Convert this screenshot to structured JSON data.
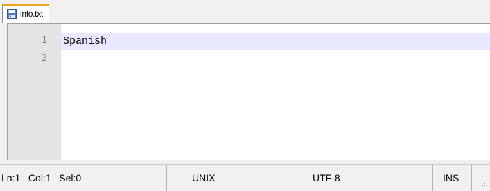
{
  "tabs": [
    {
      "label": "info.txt",
      "icon": "save-icon",
      "accent_color": "#f3a21b"
    }
  ],
  "editor": {
    "line_numbers": [
      "1",
      "2"
    ],
    "lines": [
      "Spanish",
      ""
    ],
    "current_line_color": "#e8e8ff",
    "gutter_color": "#e4e4e4"
  },
  "statusbar": {
    "position": "Ln:1   Col:1   Sel:0",
    "eol": "UNIX",
    "encoding": "UTF-8",
    "mode": "INS"
  }
}
